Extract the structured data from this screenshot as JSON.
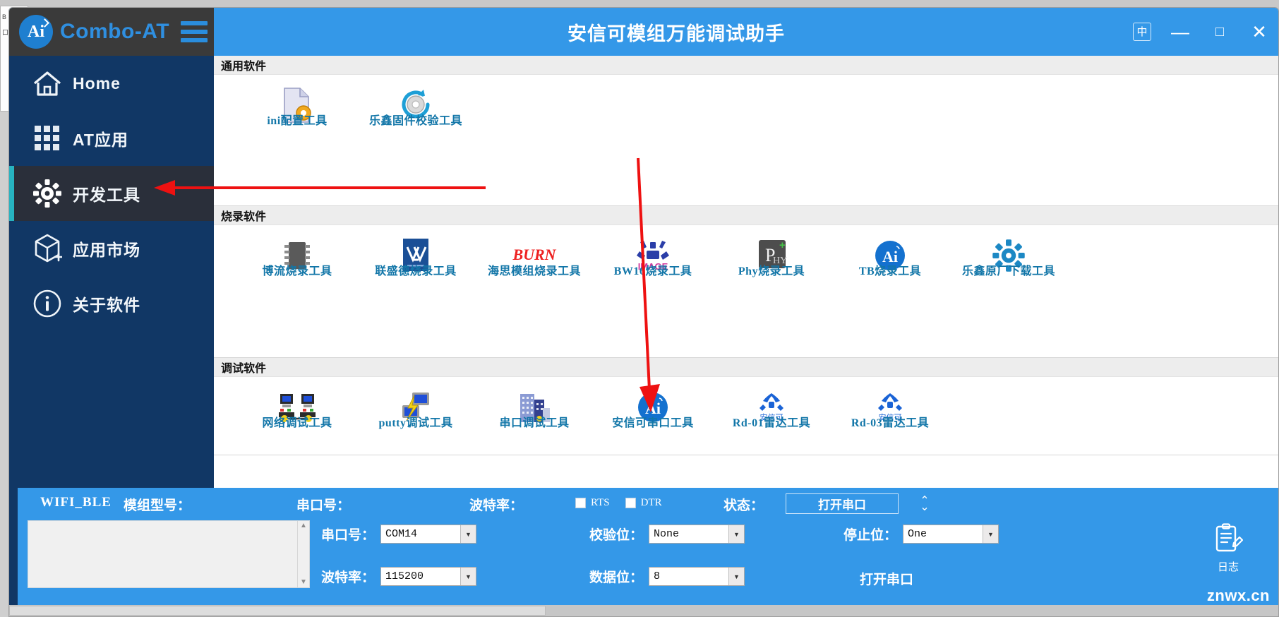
{
  "window": {
    "title": "安信可模组万能调试助手",
    "brand": "Combo-AT",
    "logo_text": "Ai",
    "controls": {
      "lang": "中",
      "minimize": "—",
      "maximize": "□",
      "close": "✕"
    }
  },
  "sidebar": {
    "items": [
      {
        "label": "Home",
        "icon": "home-icon",
        "active": false
      },
      {
        "label": "AT应用",
        "icon": "grid-icon",
        "active": false
      },
      {
        "label": "开发工具",
        "icon": "gear-icon",
        "active": true
      },
      {
        "label": "应用市场",
        "icon": "cube-plus-icon",
        "active": false
      },
      {
        "label": "关于软件",
        "icon": "info-icon",
        "active": false
      }
    ]
  },
  "sections": [
    {
      "title": "通用软件",
      "tiles": [
        {
          "label": "ini配置工具",
          "icon": "file-gear-icon"
        },
        {
          "label": "乐鑫固件校验工具",
          "icon": "refresh-gear-icon"
        }
      ]
    },
    {
      "title": "烧录软件",
      "tiles": [
        {
          "label": "博流烧录工具",
          "icon": "chip-icon"
        },
        {
          "label": "联盛德烧录工具",
          "icon": "xx-logo-icon"
        },
        {
          "label": "海思模组烧录工具",
          "icon": "burn-text-icon"
        },
        {
          "label": "BW16烧录工具",
          "icon": "image-logo-icon"
        },
        {
          "label": "Phy烧录工具",
          "icon": "phy-logo-icon"
        },
        {
          "label": "TB烧录工具",
          "icon": "ai-circle-icon"
        },
        {
          "label": "乐鑫原厂下载工具",
          "icon": "blue-gear-icon"
        }
      ]
    },
    {
      "title": "调试软件",
      "tiles": [
        {
          "label": "网络调试工具",
          "icon": "network-icon"
        },
        {
          "label": "putty调试工具",
          "icon": "putty-icon"
        },
        {
          "label": "串口调试工具",
          "icon": "buildings-icon"
        },
        {
          "label": "安信可串口工具",
          "icon": "ai-circle-icon"
        },
        {
          "label": "Rd-01雷达工具",
          "icon": "radar-icon"
        },
        {
          "label": "Rd-03雷达工具",
          "icon": "radar-icon"
        }
      ]
    }
  ],
  "bottom": {
    "wifi_ble": "WIFI_BLE",
    "model_label": "模组型号：",
    "port_label_top": "串口号：",
    "baud_label_top": "波特率：",
    "state_label": "状态：",
    "open_button": "打开串口",
    "open_text": "打开串口",
    "rts": "RTS",
    "dtr": "DTR",
    "log_value": "",
    "fields": {
      "port": {
        "label": "串口号：",
        "value": "COM14"
      },
      "baud": {
        "label": "波特率：",
        "value": "115200"
      },
      "parity": {
        "label": "校验位：",
        "value": "None"
      },
      "databits": {
        "label": "数据位：",
        "value": "8"
      },
      "stopbits": {
        "label": "停止位：",
        "value": "One"
      }
    },
    "log_tool_label": "日志",
    "watermark": "znwx.cn"
  },
  "ghost_window": {
    "line1": "B",
    "line2": "口"
  },
  "colors": {
    "accent": "#3498e8",
    "sidebar": "#113765",
    "sidebar_active": "#2a2f3a",
    "active_bar": "#27b3c0",
    "tile_label": "#1276a8",
    "annotation": "#ee1111"
  }
}
